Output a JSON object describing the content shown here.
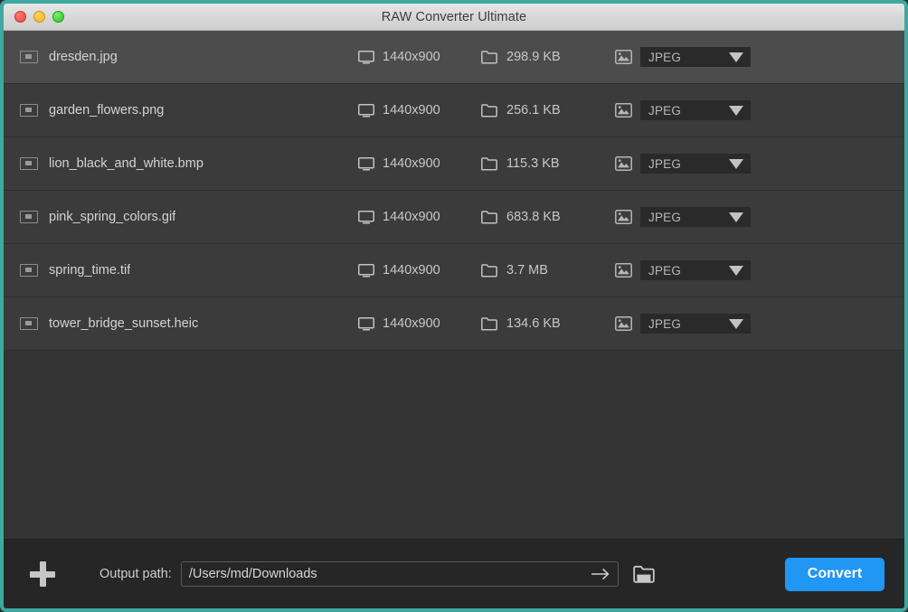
{
  "window": {
    "title": "RAW Converter Ultimate",
    "traffic_lights": [
      "close",
      "minimize",
      "zoom"
    ],
    "accent_color": "#2196f3",
    "border_color": "#3fa9a0"
  },
  "file_list": {
    "rows": [
      {
        "name": "dresden.jpg",
        "dimensions": "1440x900",
        "size": "298.9 KB",
        "format": "JPEG",
        "selected": true
      },
      {
        "name": "garden_flowers.png",
        "dimensions": "1440x900",
        "size": "256.1 KB",
        "format": "JPEG",
        "selected": false
      },
      {
        "name": "lion_black_and_white.bmp",
        "dimensions": "1440x900",
        "size": "115.3 KB",
        "format": "JPEG",
        "selected": false
      },
      {
        "name": "pink_spring_colors.gif",
        "dimensions": "1440x900",
        "size": "683.8 KB",
        "format": "JPEG",
        "selected": false
      },
      {
        "name": "spring_time.tif",
        "dimensions": "1440x900",
        "size": "3.7 MB",
        "format": "JPEG",
        "selected": false
      },
      {
        "name": "tower_bridge_sunset.heic",
        "dimensions": "1440x900",
        "size": "134.6 KB",
        "format": "JPEG",
        "selected": false
      }
    ],
    "icons": {
      "file": "image-file-icon",
      "dimensions": "monitor-icon",
      "size": "folder-icon",
      "format": "picture-icon",
      "dropdown": "caret-down-icon"
    }
  },
  "bottom_bar": {
    "add_icon": "plus-icon",
    "output_label": "Output path:",
    "output_path": "/Users/md/Downloads",
    "output_path_placeholder": "/Users/md/Downloads",
    "go_icon": "arrow-right-icon",
    "browse_icon": "folder-open-icon",
    "convert_label": "Convert"
  }
}
